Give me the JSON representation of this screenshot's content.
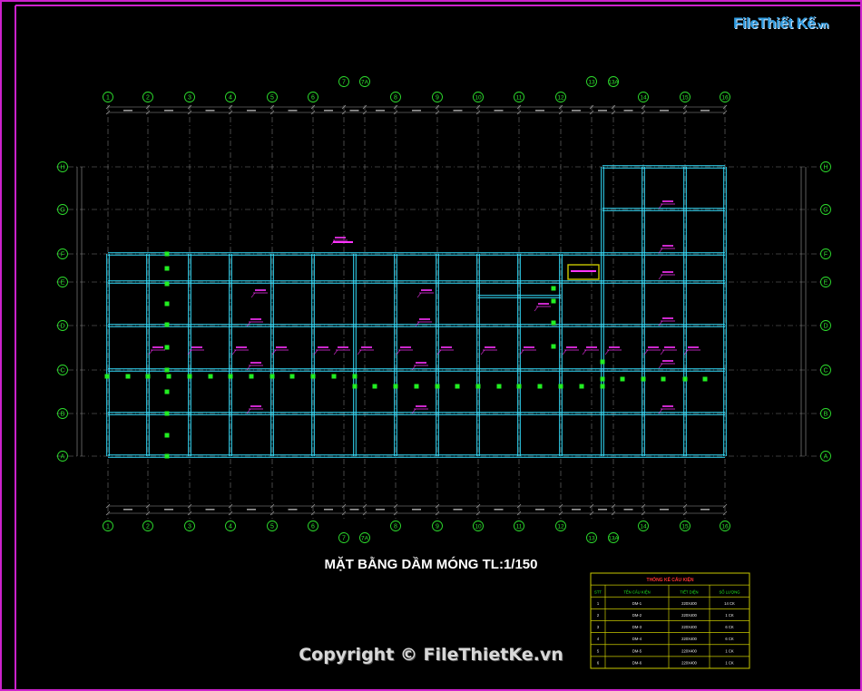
{
  "drawing": {
    "title": "MẶT BẰNG DẦM MÓNG TL:1/150",
    "copyright": "Copyright © FileThietKe.vn",
    "logo": {
      "brand": "FileThiết Kế",
      "suffix": ".vn"
    },
    "grid_columns": [
      "1",
      "2",
      "3",
      "4",
      "5",
      "6",
      "7",
      "7A",
      "8",
      "9",
      "10",
      "11",
      "12",
      "13",
      "13A",
      "14",
      "15",
      "16"
    ],
    "grid_rows": [
      "A",
      "B",
      "C",
      "D",
      "E",
      "F",
      "G",
      "H"
    ],
    "colors": {
      "border": "#cc22cc",
      "beam": "#33e0ff",
      "grid": "#7a7a7a",
      "bubble": "#2ee02e",
      "label": "#ff33ff",
      "column": "#22ee22",
      "table": "#c8c800",
      "dim": "#9a9a9a"
    }
  },
  "table": {
    "title": "THỐNG KÊ CẤU KIỆN",
    "headers": [
      "STT",
      "TÊN CẤU KIỆN",
      "TIẾT DIỆN",
      "SỐ LƯỢNG"
    ],
    "rows": [
      [
        "1",
        "DM-1",
        "220X400",
        "14 CK"
      ],
      [
        "2",
        "DM-2",
        "220X400",
        "1 CK"
      ],
      [
        "3",
        "DM-3",
        "220X400",
        "6 CK"
      ],
      [
        "4",
        "DM-4",
        "220X400",
        "6 CK"
      ],
      [
        "5",
        "DM-5",
        "220X400",
        "1 CK"
      ],
      [
        "6",
        "DM-6",
        "220X400",
        "1 CK"
      ]
    ]
  }
}
